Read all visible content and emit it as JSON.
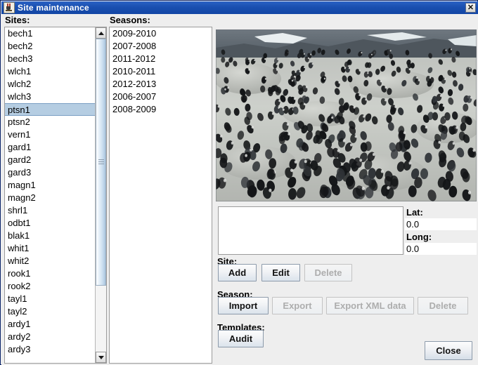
{
  "window": {
    "title": "Site maintenance",
    "icon": "java-cup-icon",
    "close_icon": "✕"
  },
  "sites_panel": {
    "label": "Sites:",
    "selected": "ptsn1",
    "items": [
      "bech1",
      "bech2",
      "bech3",
      "wlch1",
      "wlch2",
      "wlch3",
      "ptsn1",
      "ptsn2",
      "vern1",
      "gard1",
      "gard2",
      "gard3",
      "magn1",
      "magn2",
      "shrl1",
      "odbt1",
      "blak1",
      "whit1",
      "whit2",
      "rook1",
      "rook2",
      "tayl1",
      "tayl2",
      "ardy1",
      "ardy2",
      "ardy3"
    ],
    "scrollbar": {
      "up_arrow": "scroll-up",
      "down_arrow": "scroll-down",
      "thumb_fraction": 0.79
    }
  },
  "seasons_panel": {
    "label": "Seasons:",
    "items": [
      "2009-2010",
      "2007-2008",
      "2011-2012",
      "2010-2011",
      "2012-2013",
      "2006-2007",
      "2008-2009"
    ]
  },
  "photo": {
    "name": "penguin-colony-photo",
    "alt": "Adelie penguin colony on rocky ground"
  },
  "notes": {
    "value": ""
  },
  "coordinates": {
    "lat_label": "Lat:",
    "lat_value": "0.0",
    "long_label": "Long:",
    "long_value": "0.0"
  },
  "site_actions": {
    "label": "Site:",
    "buttons": [
      {
        "label": "Add",
        "enabled": true
      },
      {
        "label": "Edit",
        "enabled": true
      },
      {
        "label": "Delete",
        "enabled": false
      }
    ]
  },
  "season_actions": {
    "label": "Season:",
    "buttons": [
      {
        "label": "Import",
        "enabled": true
      },
      {
        "label": "Export",
        "enabled": false
      },
      {
        "label": "Export XML data",
        "enabled": false
      },
      {
        "label": "Delete",
        "enabled": false
      }
    ]
  },
  "template_actions": {
    "label": "Templates:",
    "buttons": [
      {
        "label": "Audit",
        "enabled": true
      }
    ]
  },
  "footer": {
    "close_label": "Close"
  },
  "colors": {
    "titlebar": "#1a4fb0",
    "selection": "#b5cde2",
    "panel_bg": "#eeeeee",
    "field_bg": "#ffffff",
    "disabled_text": "#adadad"
  }
}
